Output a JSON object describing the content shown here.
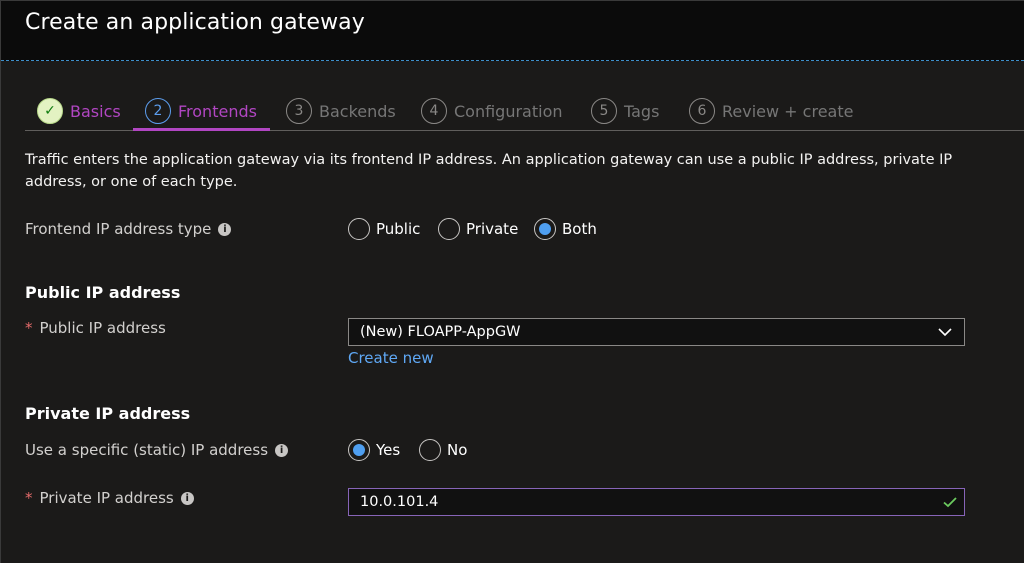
{
  "header": {
    "title": "Create an application gateway"
  },
  "tabs": [
    {
      "num": "✓",
      "label": "Basics"
    },
    {
      "num": "2",
      "label": "Frontends"
    },
    {
      "num": "3",
      "label": "Backends"
    },
    {
      "num": "4",
      "label": "Configuration"
    },
    {
      "num": "5",
      "label": "Tags"
    },
    {
      "num": "6",
      "label": "Review + create"
    }
  ],
  "description": "Traffic enters the application gateway via its frontend IP address. An application gateway can use a public IP address, private IP address, or one of each type.",
  "frontend_type": {
    "label": "Frontend IP address type",
    "options": [
      "Public",
      "Private",
      "Both"
    ],
    "selected": "Both"
  },
  "public_ip": {
    "section_title": "Public IP address",
    "field_label": "Public IP address",
    "required_mark": "*",
    "selected_value": "(New) FLOAPP-AppGW",
    "create_new": "Create new"
  },
  "private_ip": {
    "section_title": "Private IP address",
    "static_label": "Use a specific (static) IP address",
    "static_options": [
      "Yes",
      "No"
    ],
    "static_selected": "Yes",
    "field_label": "Private IP address",
    "required_mark": "*",
    "value": "10.0.101.4"
  },
  "icons": {
    "info": "i"
  },
  "colors": {
    "accent_purple": "#b146c2",
    "radio_blue": "#4f9ff0",
    "link_blue": "#5fa8f5",
    "valid_green": "#6ccb5f"
  }
}
